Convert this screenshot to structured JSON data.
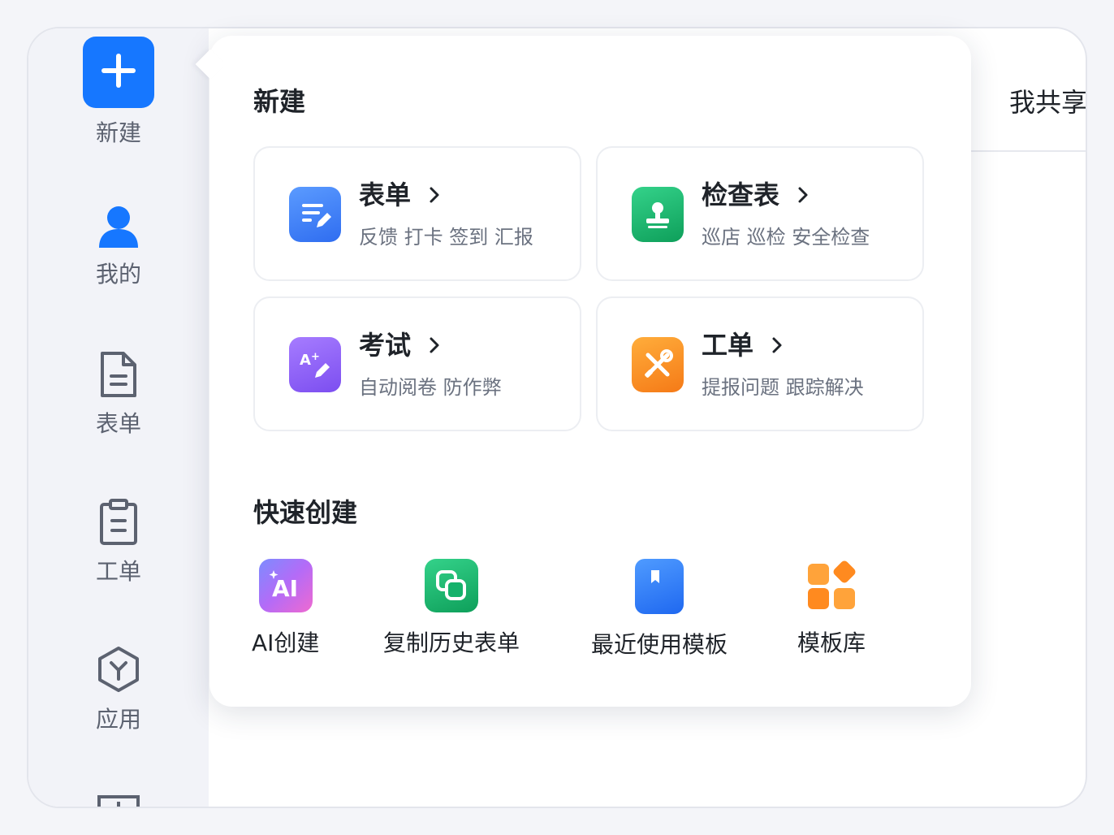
{
  "sidebar": {
    "items": [
      {
        "label": "新建",
        "icon": "plus-icon"
      },
      {
        "label": "我的",
        "icon": "user-icon"
      },
      {
        "label": "表单",
        "icon": "document-icon"
      },
      {
        "label": "工单",
        "icon": "clipboard-icon"
      },
      {
        "label": "应用",
        "icon": "hexagon-app-icon"
      }
    ]
  },
  "topbar": {
    "tab_label": "我共享"
  },
  "popover": {
    "new_title": "新建",
    "cards": [
      {
        "title": "表单",
        "subtitle": "反馈 打卡 签到 汇报",
        "icon": "form-edit-icon",
        "color": "#3d7bf7"
      },
      {
        "title": "检查表",
        "subtitle": "巡店 巡检 安全检查",
        "icon": "stamp-icon",
        "color": "#12b76a"
      },
      {
        "title": "考试",
        "subtitle": "自动阅卷 防作弊",
        "icon": "exam-grade-icon",
        "color": "#8b5cf6"
      },
      {
        "title": "工单",
        "subtitle": "提报问题 跟踪解决",
        "icon": "tools-icon",
        "color": "#f97316"
      }
    ],
    "quick_title": "快速创建",
    "quick_items": [
      {
        "label": "AI创建",
        "icon": "ai-icon"
      },
      {
        "label": "复制历史表单",
        "icon": "copy-icon"
      },
      {
        "label": "最近使用模板",
        "icon": "bookmark-icon"
      },
      {
        "label": "模板库",
        "icon": "template-grid-icon"
      }
    ]
  },
  "colors": {
    "primary": "#1677ff",
    "text": "#1f2329",
    "muted": "#6b7280"
  }
}
